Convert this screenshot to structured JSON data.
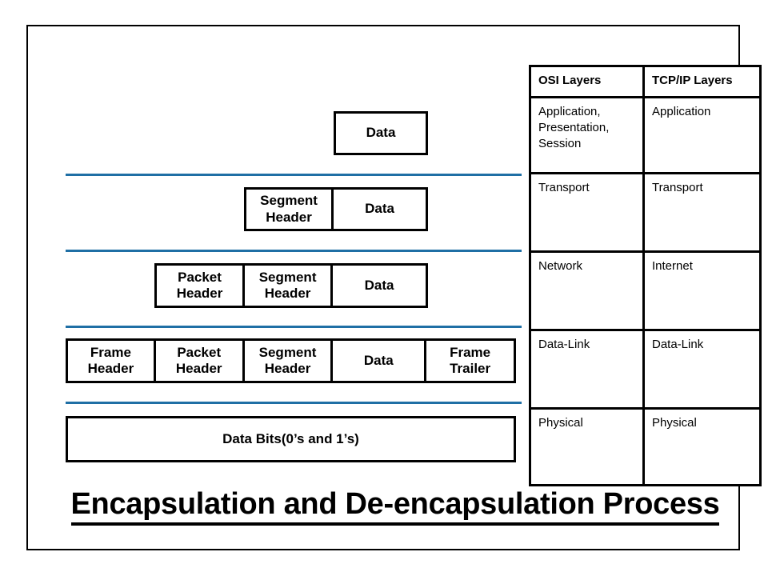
{
  "title": {
    "text": "Encapsulation and De-encapsulation Process"
  },
  "encapsulation": {
    "rows": [
      {
        "name": "data-row",
        "cells": [
          {
            "label": "Data"
          }
        ]
      },
      {
        "name": "segment-row",
        "cells": [
          {
            "label": "Segment Header"
          },
          {
            "label": "Data"
          }
        ]
      },
      {
        "name": "packet-row",
        "cells": [
          {
            "label": "Packet Header"
          },
          {
            "label": "Segment Header"
          },
          {
            "label": "Data"
          }
        ]
      },
      {
        "name": "frame-row",
        "cells": [
          {
            "label": "Frame Header"
          },
          {
            "label": "Packet Header"
          },
          {
            "label": "Segment Header"
          },
          {
            "label": "Data"
          },
          {
            "label": "Frame Trailer"
          }
        ]
      },
      {
        "name": "bits-row",
        "cells": [
          {
            "label": "Data Bits(0’s and 1’s)"
          }
        ]
      }
    ],
    "divider_color": "#1F6FA5"
  },
  "layers_table": {
    "header": {
      "osi": "OSI Layers",
      "tcpip": "TCP/IP Layers"
    },
    "rows": [
      {
        "osi": "Application, Presentation, Session",
        "tcpip": "Application"
      },
      {
        "osi": "Transport",
        "tcpip": "Transport"
      },
      {
        "osi": "Network",
        "tcpip": "Internet"
      },
      {
        "osi": "Data-Link",
        "tcpip": "Data-Link"
      },
      {
        "osi": "Physical",
        "tcpip": "Physical"
      }
    ]
  }
}
